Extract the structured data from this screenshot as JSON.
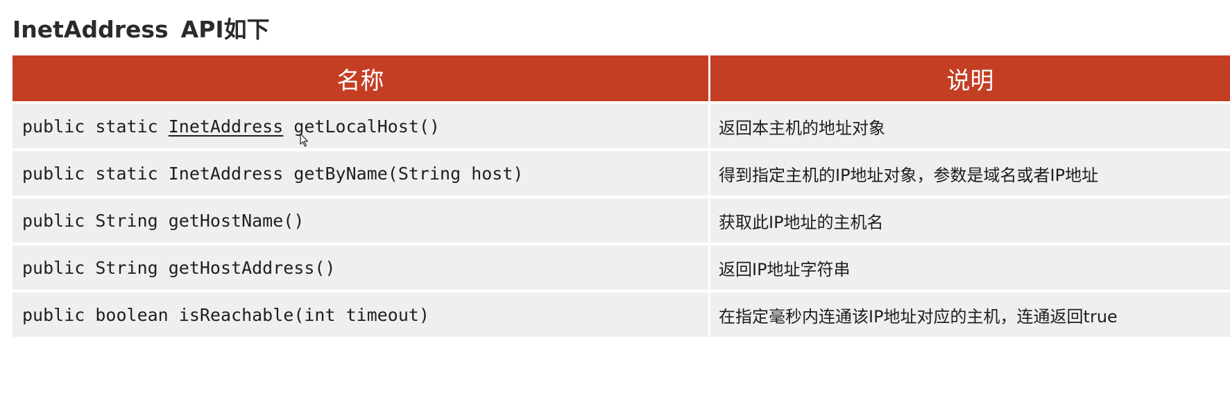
{
  "title": {
    "class_name": "InetAddress",
    "suffix": "API如下"
  },
  "table": {
    "headers": {
      "name": "名称",
      "description": "说明"
    },
    "rows": [
      {
        "sig_before": "public static ",
        "sig_link": "InetAddress",
        "sig_after": " getLocalHost()",
        "description": "返回本主机的地址对象"
      },
      {
        "signature": "public static InetAddress getByName(String host)",
        "description": "得到指定主机的IP地址对象，参数是域名或者IP地址"
      },
      {
        "signature": "public String getHostName()",
        "description": "获取此IP地址的主机名"
      },
      {
        "signature": "public String getHostAddress()",
        "description": "返回IP地址字符串"
      },
      {
        "signature": "public boolean isReachable(int timeout)",
        "description": "在指定毫秒内连通该IP地址对应的主机，连通返回true"
      }
    ]
  },
  "colors": {
    "header_bg": "#c43e24",
    "row_bg": "#efefef",
    "header_text": "#ffffff"
  },
  "icons": {
    "cursor": "mouse-pointer-icon"
  }
}
